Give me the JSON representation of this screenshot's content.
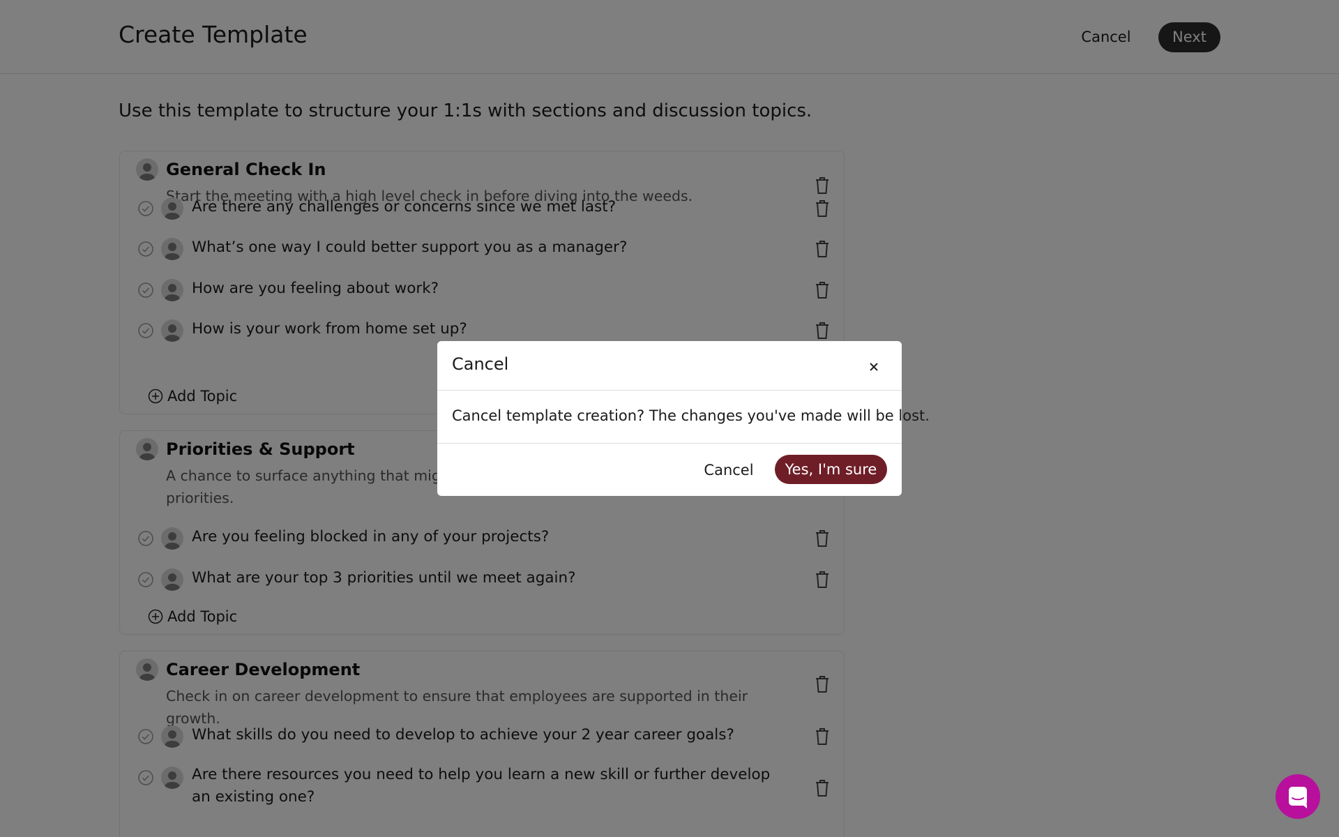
{
  "header": {
    "title": "Create Template",
    "cancel_label": "Cancel",
    "next_label": "Next"
  },
  "intro": "Use this template to structure your 1:1s with sections and discussion topics.",
  "sections": [
    {
      "title": "General Check In",
      "description": "Start the meeting with a high level check in before diving into the weeds.",
      "topics": [
        "Are there any challenges or concerns since we met last?",
        "What’s one way I could better support you as a manager?",
        "How are you feeling about work?",
        "How is your work from home set up?"
      ],
      "add_topic_label": "Add Topic"
    },
    {
      "title": "Priorities & Support",
      "description": "A chance to surface anything that might",
      "description_line2": "priorities.",
      "topics": [
        "Are you feeling blocked in any of your projects?",
        "What are your top 3 priorities until we meet again?"
      ],
      "add_topic_label": "Add Topic"
    },
    {
      "title": "Career Development",
      "description": "Check in on career development to ensure that employees are supported in their growth.",
      "topics": [
        "What skills do you need to develop to achieve your 2 year career goals?",
        "Are there resources you need to help you learn a new skill or further develop an existing one?"
      ]
    }
  ],
  "modal": {
    "title": "Cancel",
    "message": "Cancel template creation? The changes you've made will be lost.",
    "cancel_label": "Cancel",
    "confirm_label": "Yes, I'm sure"
  },
  "colors": {
    "confirm": "#6f1e27",
    "chat": "#b8109d",
    "primary": "#2d2d2d"
  },
  "icons": {
    "trash": "trash-icon",
    "check": "check-circle-icon",
    "close": "close-icon",
    "chat": "chat-icon",
    "add": "plus-circle-icon"
  }
}
